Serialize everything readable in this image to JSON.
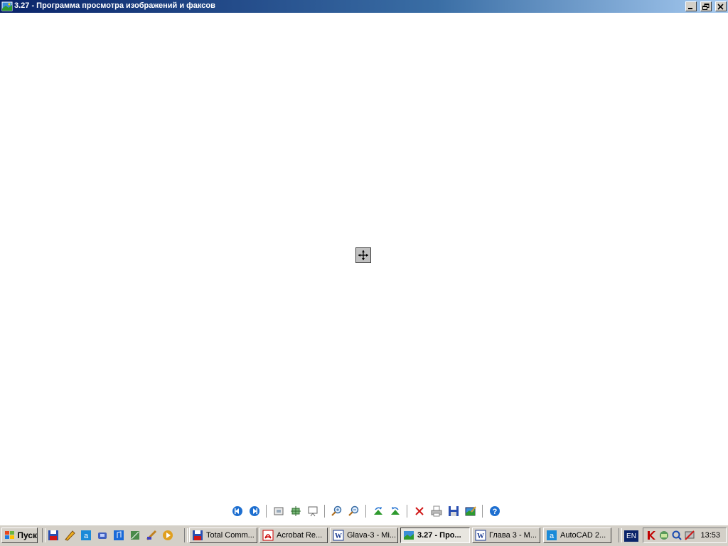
{
  "window": {
    "title": "3.27 - Программа просмотра изображений и факсов"
  },
  "toolbar": {
    "tools": [
      {
        "icon": "previous-image-icon"
      },
      {
        "icon": "next-image-icon"
      },
      {
        "icon": "best-fit-icon"
      },
      {
        "icon": "actual-size-icon"
      },
      {
        "icon": "slideshow-icon"
      },
      {
        "icon": "zoom-in-icon"
      },
      {
        "icon": "zoom-out-icon"
      },
      {
        "icon": "rotate-clockwise-icon"
      },
      {
        "icon": "rotate-counterclockwise-icon"
      },
      {
        "icon": "delete-icon"
      },
      {
        "icon": "print-icon"
      },
      {
        "icon": "save-icon"
      },
      {
        "icon": "edit-icon"
      },
      {
        "icon": "help-icon"
      }
    ]
  },
  "taskbar": {
    "start_label": "Пуск",
    "tasks": [
      {
        "label": "Total Comm...",
        "icon": "floppy-icon"
      },
      {
        "label": "Acrobat Re...",
        "icon": "acrobat-icon"
      },
      {
        "label": "Glava-3 - Mi...",
        "icon": "word-icon"
      },
      {
        "label": "3.27 - Про...",
        "icon": "image-viewer-icon",
        "active": true
      },
      {
        "label": "Глава 3 - M...",
        "icon": "word-icon"
      },
      {
        "label": "AutoCAD 2...",
        "icon": "autocad-icon"
      }
    ],
    "language": "EN",
    "clock": "13:53"
  }
}
